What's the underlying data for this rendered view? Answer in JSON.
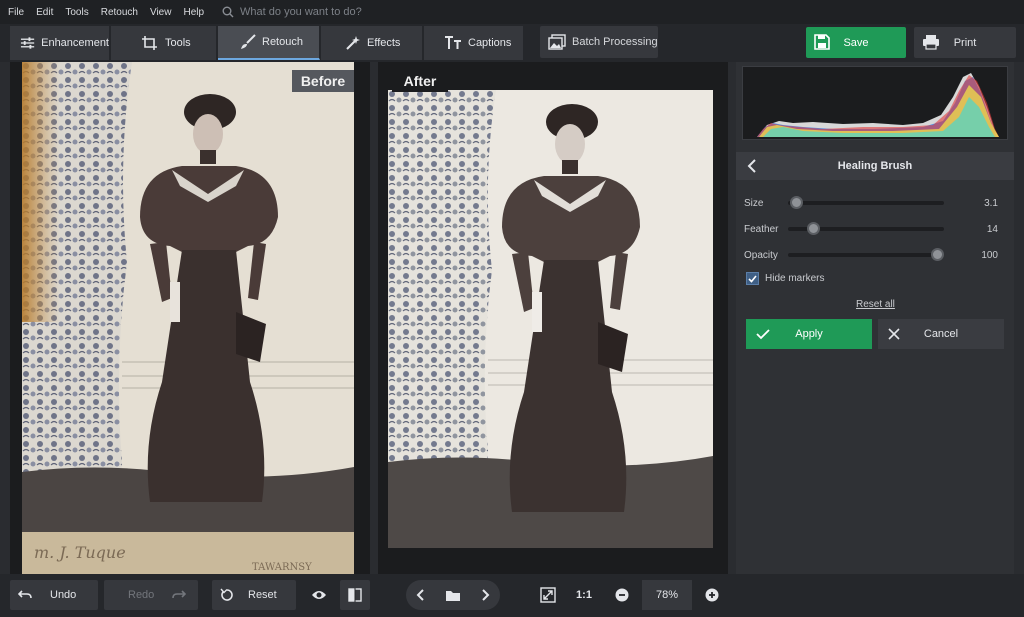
{
  "menu": {
    "items": [
      "File",
      "Edit",
      "Tools",
      "Retouch",
      "View",
      "Help"
    ],
    "search_placeholder": "What do you want to do?"
  },
  "tabs": [
    {
      "label": "Enhancement",
      "icon": "sliders-icon"
    },
    {
      "label": "Tools",
      "icon": "crop-icon"
    },
    {
      "label": "Retouch",
      "icon": "brush-icon",
      "active": true
    },
    {
      "label": "Effects",
      "icon": "wand-icon"
    },
    {
      "label": "Captions",
      "icon": "text-icon"
    }
  ],
  "toolbar": {
    "batch_label": "Batch Processing",
    "save_label": "Save",
    "print_label": "Print"
  },
  "canvas": {
    "before_label": "Before",
    "after_label": "After"
  },
  "bottom": {
    "undo_label": "Undo",
    "redo_label": "Redo",
    "reset_label": "Reset",
    "fit_label": "1:1",
    "zoom_value": "78%"
  },
  "panel": {
    "title": "Healing Brush",
    "controls": [
      {
        "label": "Size",
        "value": "3.1",
        "fraction": 0.03
      },
      {
        "label": "Feather",
        "value": "14",
        "fraction": 0.14
      },
      {
        "label": "Opacity",
        "value": "100",
        "fraction": 1.0
      }
    ],
    "hide_markers_label": "Hide markers",
    "hide_markers_checked": true,
    "reset_all_label": "Reset all",
    "apply_label": "Apply",
    "cancel_label": "Cancel"
  },
  "colors": {
    "accent_green": "#1f9a57",
    "active_tab_underline": "#6da8e0"
  }
}
